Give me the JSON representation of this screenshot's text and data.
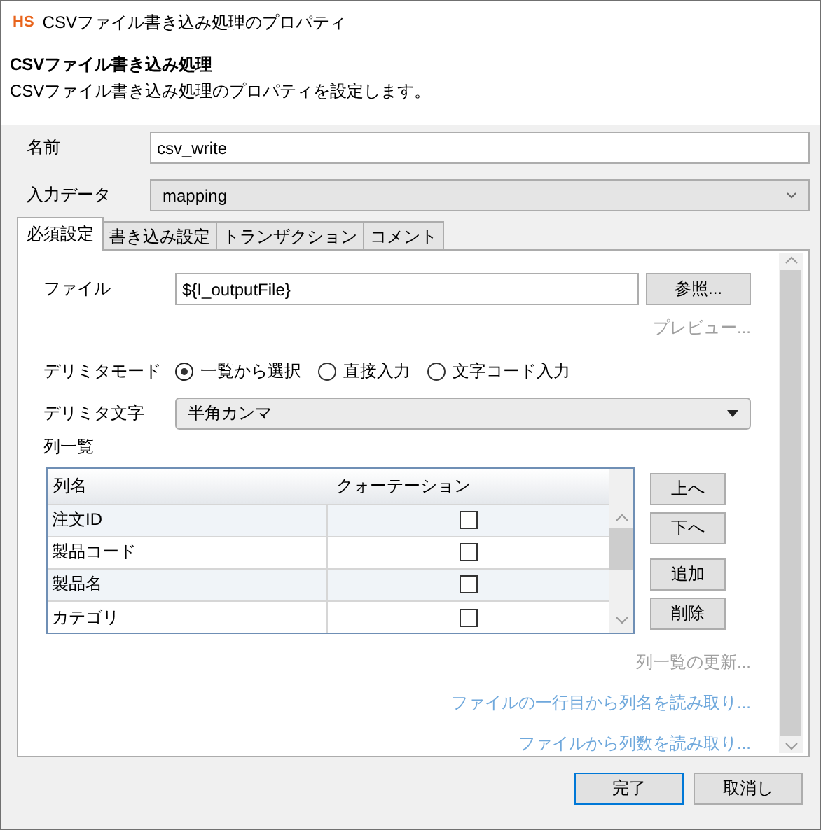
{
  "window": {
    "logo": "HS",
    "title": "CSVファイル書き込み処理のプロパティ"
  },
  "header": {
    "title": "CSVファイル書き込み処理",
    "description": "CSVファイル書き込み処理のプロパティを設定します。"
  },
  "name_field": {
    "label": "名前",
    "value": "csv_write"
  },
  "input_data": {
    "label": "入力データ",
    "value": "mapping"
  },
  "tabs": [
    {
      "label": "必須設定",
      "selected": true
    },
    {
      "label": "書き込み設定",
      "selected": false
    },
    {
      "label": "トランザクション",
      "selected": false
    },
    {
      "label": "コメント",
      "selected": false
    }
  ],
  "file": {
    "label": "ファイル",
    "value": "${I_outputFile}",
    "browse_button": "参照..."
  },
  "preview_link": {
    "label": "プレビュー...",
    "disabled": true
  },
  "delimiter_mode": {
    "label": "デリミタモード",
    "options": [
      {
        "label": "一覧から選択",
        "selected": true
      },
      {
        "label": "直接入力",
        "selected": false
      },
      {
        "label": "文字コード入力",
        "selected": false
      }
    ]
  },
  "delimiter_char": {
    "label": "デリミタ文字",
    "value": "半角カンマ"
  },
  "column_list": {
    "label": "列一覧",
    "columns": [
      "列名",
      "クォーテーション"
    ],
    "rows": [
      {
        "name": "注文ID",
        "quoted": false
      },
      {
        "name": "製品コード",
        "quoted": false
      },
      {
        "name": "製品名",
        "quoted": false
      },
      {
        "name": "カテゴリ",
        "quoted": false
      }
    ],
    "buttons": [
      "上へ",
      "下へ",
      "追加",
      "削除"
    ]
  },
  "links": [
    {
      "label": "列一覧の更新...",
      "disabled": true
    },
    {
      "label": "ファイルの一行目から列名を読み取り...",
      "disabled": false
    },
    {
      "label": "ファイルから列数を読み取り...",
      "disabled": false
    }
  ],
  "footer_buttons": [
    {
      "label": "完了",
      "default": true
    },
    {
      "label": "取消し",
      "default": false
    }
  ]
}
